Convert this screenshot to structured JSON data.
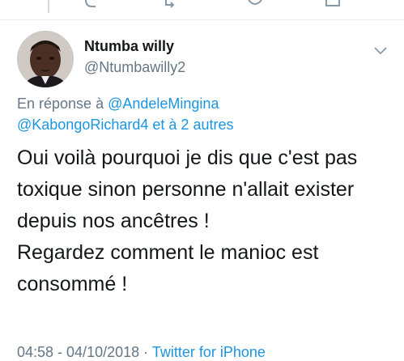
{
  "thread": {
    "actions": [
      {
        "icon": "reply-icon"
      },
      {
        "icon": "retweet-icon"
      },
      {
        "icon": "like-icon"
      },
      {
        "icon": "share-icon"
      }
    ]
  },
  "tweet": {
    "author_name": "Ntumba willy",
    "author_handle": "@Ntumbawilly2",
    "reply_prefix": "En réponse à",
    "reply_mention_1": "@AndeleMingina",
    "reply_mention_2": "@KabongoRichard4",
    "reply_suffix": "et à 2 autres",
    "text_lines": [
      "Oui voilà pourquoi je dis que c'est pas",
      "toxique sinon personne n'allait exister",
      "depuis nos ancêtres !",
      "Regardez comment le manioc est",
      "consommé !"
    ],
    "timestamp": "04:58 - 04/10/2018",
    "source": "Twitter for iPhone"
  },
  "colors": {
    "link": "#1b95e0",
    "muted": "#657786",
    "text": "#14171a"
  }
}
